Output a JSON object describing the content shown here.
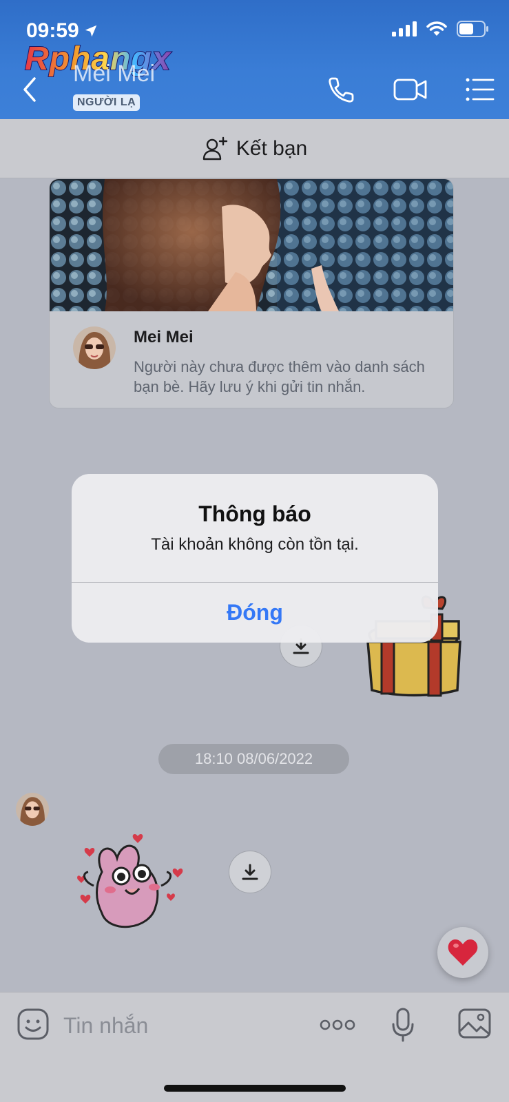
{
  "status_bar": {
    "time": "09:59"
  },
  "watermark": {
    "text": "Rphangx"
  },
  "header": {
    "contact_name": "Mei Mei",
    "badge": "NGƯỜI LẠ"
  },
  "add_friend": {
    "label": "Kết bạn"
  },
  "profile_card": {
    "name": "Mei Mei",
    "description": "Người này chưa được thêm vào danh sách bạn bè. Hãy lưu ý khi gửi tin nhắn."
  },
  "dialog": {
    "title": "Thông báo",
    "message": "Tài khoản không còn tồn tại.",
    "close_label": "Đóng"
  },
  "chat": {
    "timestamp": "18:10 08/06/2022"
  },
  "input": {
    "placeholder": "Tin nhắn"
  },
  "colors": {
    "header_blue": "#3a7dd6",
    "accent_blue": "#3478f6",
    "heart_red": "#d7263d"
  }
}
